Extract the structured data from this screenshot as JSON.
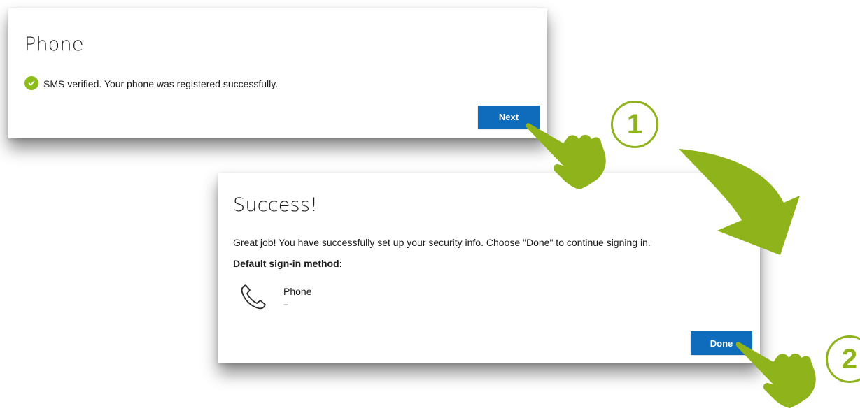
{
  "phone_dialog": {
    "title": "Phone",
    "status_message": "SMS verified. Your phone was registered successfully.",
    "next_label": "Next"
  },
  "success_dialog": {
    "title": "Success!",
    "message": "Great job! You have successfully set up your security info. Choose \"Done\" to continue signing in.",
    "default_method_heading": "Default sign-in method:",
    "method_name": "Phone",
    "method_value": "+",
    "done_label": "Done"
  },
  "steps": [
    "1",
    "2"
  ],
  "colors": {
    "button_blue": "#0f6cbd",
    "check_green": "#8cbd18",
    "annotation_green": "#8fb31a"
  },
  "icons": {
    "status": "check-circle-icon",
    "method": "phone-icon",
    "pointer": "hand-pointer-icon",
    "flow": "curved-arrow-icon"
  }
}
